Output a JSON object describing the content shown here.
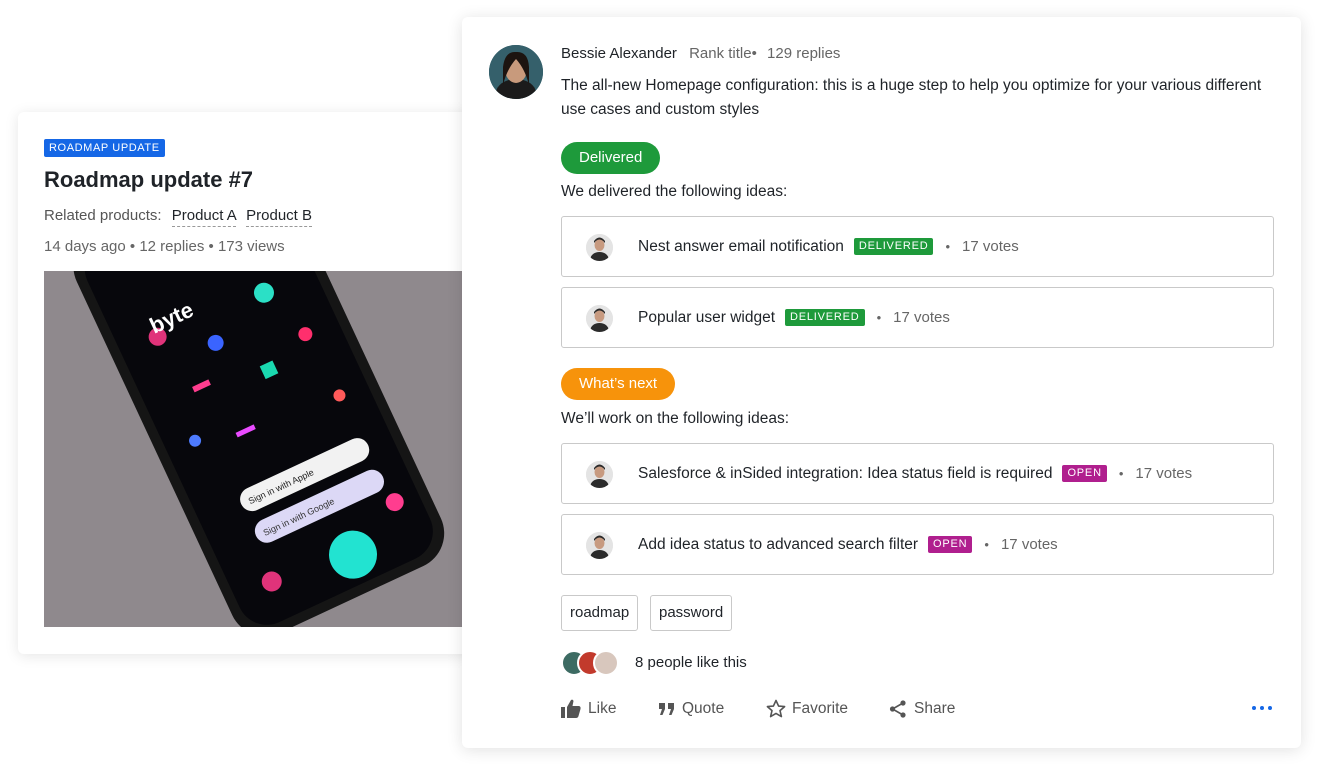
{
  "roadmap_card": {
    "badge": "ROADMAP UPDATE",
    "title": "Roadmap update #7",
    "related_label": "Related products:",
    "products": [
      "Product A",
      "Product B"
    ],
    "meta": "14 days ago • 12 replies •  173 views",
    "hero_brand": "byte",
    "hero_buttons": [
      "Sign in with Apple",
      "Sign in with Google"
    ]
  },
  "post": {
    "author": "Bessie Alexander",
    "rank": "Rank title•",
    "replies": "129 replies",
    "body": "The all-new Homepage configuration: this is a huge step to help you optimize for your various different use cases and custom styles",
    "delivered_pill": "Delivered",
    "delivered_intro": "We delivered the following ideas:",
    "next_pill": "What’s next",
    "next_intro": "We’ll work on the following ideas:",
    "delivered_ideas": [
      {
        "title": "Nest answer email notification",
        "status": "DELIVERED",
        "votes": "17 votes"
      },
      {
        "title": "Popular user widget",
        "status": "DELIVERED",
        "votes": "17 votes"
      }
    ],
    "next_ideas": [
      {
        "title": "Salesforce & inSided integration: Idea status field is required",
        "status": "OPEN",
        "votes": "17 votes"
      },
      {
        "title": "Add idea status to advanced search filter",
        "status": "OPEN",
        "votes": "17 votes"
      }
    ],
    "tags": [
      "roadmap",
      "password"
    ],
    "likes_text": "8 people like this",
    "actions": {
      "like": "Like",
      "quote": "Quote",
      "favorite": "Favorite",
      "share": "Share"
    }
  },
  "colors": {
    "badge_blue": "#1567e6",
    "delivered_green": "#1e9a3b",
    "next_orange": "#f7930b",
    "open_purple": "#b01f8e"
  },
  "icons": [
    "thumbs-up-icon",
    "quote-icon",
    "star-icon",
    "share-icon",
    "more-icon"
  ]
}
